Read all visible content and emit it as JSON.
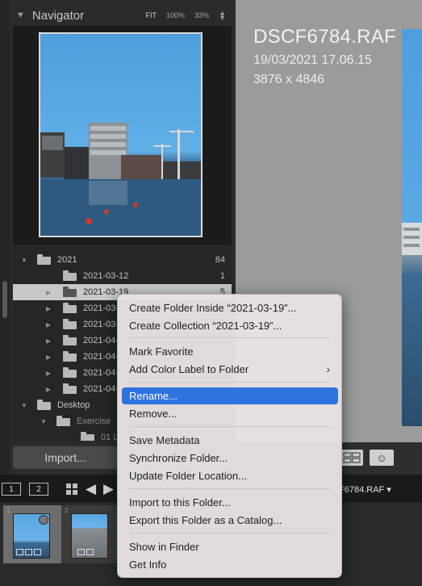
{
  "navigator": {
    "title": "Navigator",
    "zoom_fit": "FIT",
    "zoom_100": "100%",
    "zoom_33": "33%"
  },
  "folders": {
    "rows": [
      {
        "name": "2021",
        "count": "84",
        "expand": "▼",
        "level": 0
      },
      {
        "name": "2021-03-12",
        "count": "1",
        "expand": "",
        "level": 1
      },
      {
        "name": "2021-03-19",
        "count": "5",
        "expand": "▶",
        "level": 1,
        "selected": true
      },
      {
        "name": "2021-03-",
        "count": "",
        "expand": "▶",
        "level": 1
      },
      {
        "name": "2021-03-",
        "count": "",
        "expand": "▶",
        "level": 1
      },
      {
        "name": "2021-04-",
        "count": "",
        "expand": "▶",
        "level": 1
      },
      {
        "name": "2021-04-",
        "count": "",
        "expand": "▶",
        "level": 1
      },
      {
        "name": "2021-04-",
        "count": "",
        "expand": "▶",
        "level": 1
      },
      {
        "name": "2021-04-",
        "count": "",
        "expand": "▶",
        "level": 1
      },
      {
        "name": "Desktop",
        "count": "",
        "expand": "▼",
        "level": 0
      },
      {
        "name": "Exercise",
        "count": "",
        "expand": "▼",
        "level": 1,
        "dim": true
      },
      {
        "name": "01 L",
        "count": "",
        "expand": "",
        "level": 2,
        "dim": true
      }
    ]
  },
  "import_button": "Import...",
  "photo": {
    "filename": "DSCF6784.RAF",
    "datetime": "19/03/2021 17.06.15",
    "dimensions": "3876 x 4846"
  },
  "filmstrip_header": {
    "monitor1": "1",
    "monitor2": "2",
    "current_file": "F6784.RAF ▾"
  },
  "filmstrip": {
    "cells": [
      {
        "num": "1"
      },
      {
        "num": "2"
      }
    ]
  },
  "context_menu": {
    "create_folder_inside": "Create Folder Inside “2021-03-19”...",
    "create_collection": "Create Collection “2021-03-19”...",
    "mark_favorite": "Mark Favorite",
    "add_color_label": "Add Color Label to Folder",
    "rename": "Rename...",
    "remove": "Remove...",
    "save_metadata": "Save Metadata",
    "synchronize_folder": "Synchronize Folder...",
    "update_folder_location": "Update Folder Location...",
    "import_to_folder": "Import to this Folder...",
    "export_as_catalog": "Export this Folder as a Catalog...",
    "show_in_finder": "Show in Finder",
    "get_info": "Get Info"
  },
  "colors": {
    "menu_highlight": "#2e73e0",
    "panel_bg": "#2b2b2b",
    "main_bg": "#9b9b9b"
  }
}
